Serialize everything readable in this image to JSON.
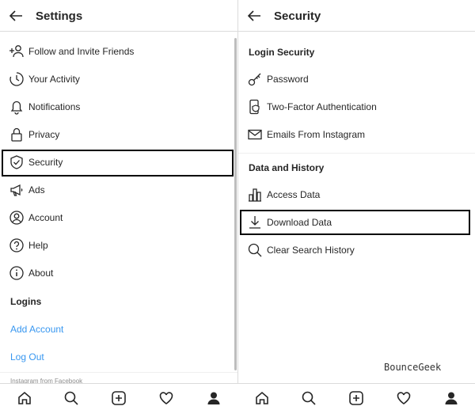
{
  "left_panel": {
    "title": "Settings",
    "items": [
      {
        "label": "Follow and Invite Friends",
        "icon": "add-person-icon"
      },
      {
        "label": "Your Activity",
        "icon": "activity-icon"
      },
      {
        "label": "Notifications",
        "icon": "bell-icon"
      },
      {
        "label": "Privacy",
        "icon": "lock-icon"
      },
      {
        "label": "Security",
        "icon": "shield-icon"
      },
      {
        "label": "Ads",
        "icon": "megaphone-icon"
      },
      {
        "label": "Account",
        "icon": "account-icon"
      },
      {
        "label": "Help",
        "icon": "help-icon"
      },
      {
        "label": "About",
        "icon": "info-icon"
      }
    ],
    "logins_heading": "Logins",
    "add_account": "Add Account",
    "log_out": "Log Out",
    "footer_text": "Instagram from Facebook"
  },
  "right_panel": {
    "title": "Security",
    "login_security_heading": "Login Security",
    "login_items": [
      {
        "label": "Password",
        "icon": "key-icon"
      },
      {
        "label": "Two-Factor Authentication",
        "icon": "phone-shield-icon"
      },
      {
        "label": "Emails From Instagram",
        "icon": "mail-icon"
      }
    ],
    "data_history_heading": "Data and History",
    "data_items": [
      {
        "label": "Access Data",
        "icon": "bar-chart-icon"
      },
      {
        "label": "Download Data",
        "icon": "download-icon"
      },
      {
        "label": "Clear Search History",
        "icon": "search-icon"
      }
    ]
  },
  "watermark": "BounceGeek",
  "bottom_nav": [
    "home-icon",
    "search-icon",
    "new-post-icon",
    "activity-heart-icon",
    "profile-icon"
  ],
  "colors": {
    "link": "#3897f0",
    "text": "#262626",
    "border": "#dbdbdb",
    "highlight": "#000000"
  }
}
